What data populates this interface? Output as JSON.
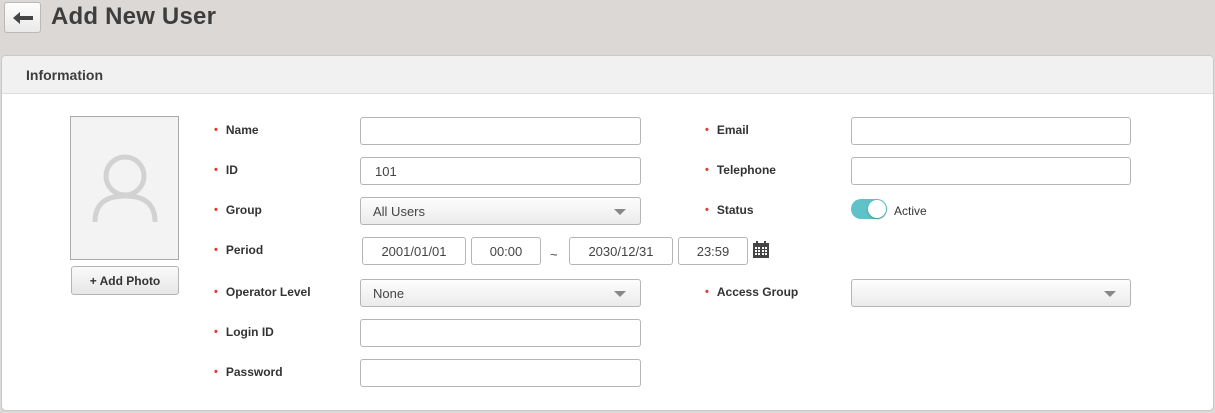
{
  "header": {
    "back_icon": "arrow-left-icon",
    "title": "Add New User"
  },
  "panel": {
    "title": "Information",
    "photo": {
      "placeholder_icon": "user-silhouette-icon",
      "add_label": "+ Add Photo"
    },
    "fields": {
      "name": {
        "label": "Name",
        "value": ""
      },
      "id": {
        "label": "ID",
        "value": "101"
      },
      "group": {
        "label": "Group",
        "value": "All Users"
      },
      "period": {
        "label": "Period",
        "start_date": "2001/01/01",
        "start_time": "00:00",
        "separator": "~",
        "end_date": "2030/12/31",
        "end_time": "23:59",
        "calendar_icon": "calendar-icon"
      },
      "operator_level": {
        "label": "Operator Level",
        "value": "None"
      },
      "login_id": {
        "label": "Login ID",
        "value": ""
      },
      "password": {
        "label": "Password",
        "value": ""
      },
      "email": {
        "label": "Email",
        "value": ""
      },
      "telephone": {
        "label": "Telephone",
        "value": ""
      },
      "status": {
        "label": "Status",
        "value": "Active",
        "on": true
      },
      "access_group": {
        "label": "Access Group",
        "value": ""
      }
    },
    "required_marker": "•"
  },
  "colors": {
    "required": "#e03c2c",
    "toggle_on": "#5fc2c9",
    "background": "#dcd8d5"
  }
}
